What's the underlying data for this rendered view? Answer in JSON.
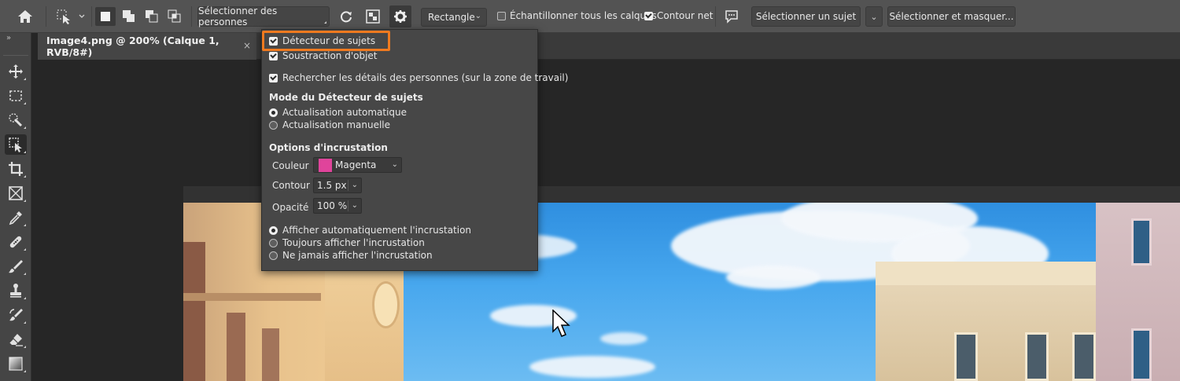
{
  "options_bar": {
    "select_people_label": "Sélectionner des personnes",
    "mode_select_value": "Rectangle",
    "sample_all_layers_label": "Échantillonner tous les calques",
    "sample_all_layers_checked": false,
    "hard_edge_label": "Contour net",
    "hard_edge_checked": true,
    "select_subject_label": "Sélectionner un sujet",
    "select_and_mask_label": "Sélectionner et masquer..."
  },
  "document_tab": {
    "title": "Image4.png @ 200% (Calque 1, RVB/8#)",
    "close_glyph": "×"
  },
  "settings_panel": {
    "object_detector_label": "Détecteur de sujets",
    "object_detector_checked": true,
    "object_subtraction_label": "Soustraction d'objet",
    "object_subtraction_checked": true,
    "find_people_details_label": "Rechercher les détails des personnes (sur la zone de travail)",
    "find_people_details_checked": true,
    "detector_mode_heading": "Mode du Détecteur de sujets",
    "detector_modes": [
      "Actualisation automatique",
      "Actualisation manuelle"
    ],
    "detector_mode_selected": 0,
    "overlay_heading": "Options d'incrustation",
    "color_label": "Couleur",
    "color_value": "Magenta",
    "color_swatch": "#e0449b",
    "stroke_label": "Contour",
    "stroke_value": "1.5 px",
    "opacity_label": "Opacité",
    "opacity_value": "100 %",
    "overlay_display_options": [
      "Afficher automatiquement l'incrustation",
      "Toujours afficher l'incrustation",
      "Ne jamais afficher l'incrustation"
    ],
    "overlay_display_selected": 0
  },
  "toolbar": {
    "tools": [
      "move-tool",
      "marquee-tool",
      "quick-selection-tool",
      "object-selection-tool",
      "crop-tool",
      "frame-tool",
      "eyedropper-tool",
      "healing-brush-tool",
      "brush-tool",
      "clone-stamp-tool",
      "history-brush-tool",
      "eraser-tool",
      "gradient-tool"
    ],
    "active_tool": "object-selection-tool"
  },
  "colors": {
    "highlight": "#f07a1f",
    "ui_bg": "#535353",
    "panel_bg": "#474747"
  }
}
